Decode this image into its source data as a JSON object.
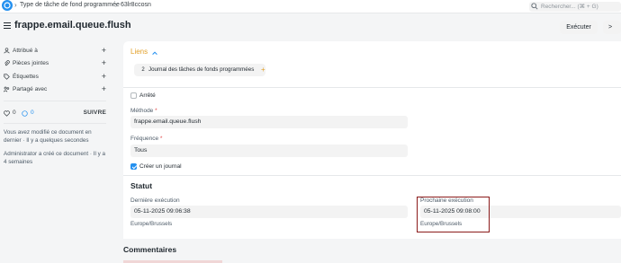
{
  "topbar": {
    "breadcrumbs": [
      "Type de tâche de fond programmée",
      "63lr8ccosn"
    ],
    "search_placeholder": "Rechercher... (⌘ + G)"
  },
  "header": {
    "title": "frappe.email.queue.flush",
    "execute_label": "Exécuter",
    "next_label": ">"
  },
  "sidebar": {
    "items": [
      {
        "label": "Attribué à",
        "icon": "assign-icon"
      },
      {
        "label": "Pièces jointes",
        "icon": "attachment-icon"
      },
      {
        "label": "Étiquettes",
        "icon": "tag-icon"
      },
      {
        "label": "Partagé avec",
        "icon": "share-icon"
      }
    ],
    "likes_count": "0",
    "comments_count": "0",
    "follow_label": "SUIVRE",
    "activity": [
      "Vous avez modifié ce document en dernier · Il y a quelques secondes",
      "Administrator a créé ce document · Il y a 4 semaines"
    ]
  },
  "links": {
    "title": "Liens",
    "item_count": "2",
    "item_label": "Journal des tâches de fonds programmées",
    "add_symbol": "+"
  },
  "form": {
    "stopped_label": "Arrêté",
    "stopped_checked": false,
    "method_label": "Méthode",
    "method_value": "frappe.email.queue.flush",
    "frequency_label": "Fréquence",
    "frequency_value": "Tous",
    "create_log_label": "Créer un journal",
    "create_log_checked": true,
    "required_mark": "*"
  },
  "status": {
    "title": "Statut",
    "last_label": "Dernière exécution",
    "last_value": "05-11-2025 09:06:38",
    "last_tz": "Europe/Brussels",
    "next_label": "Prochaine exécution",
    "next_value": "05-11-2025 09:08:00",
    "next_tz": "Europe/Brussels"
  },
  "comments": {
    "title": "Commentaires"
  },
  "colors": {
    "accent": "#2490ef",
    "links_title": "#e2a12b",
    "highlight_border": "#8b1a1a"
  }
}
